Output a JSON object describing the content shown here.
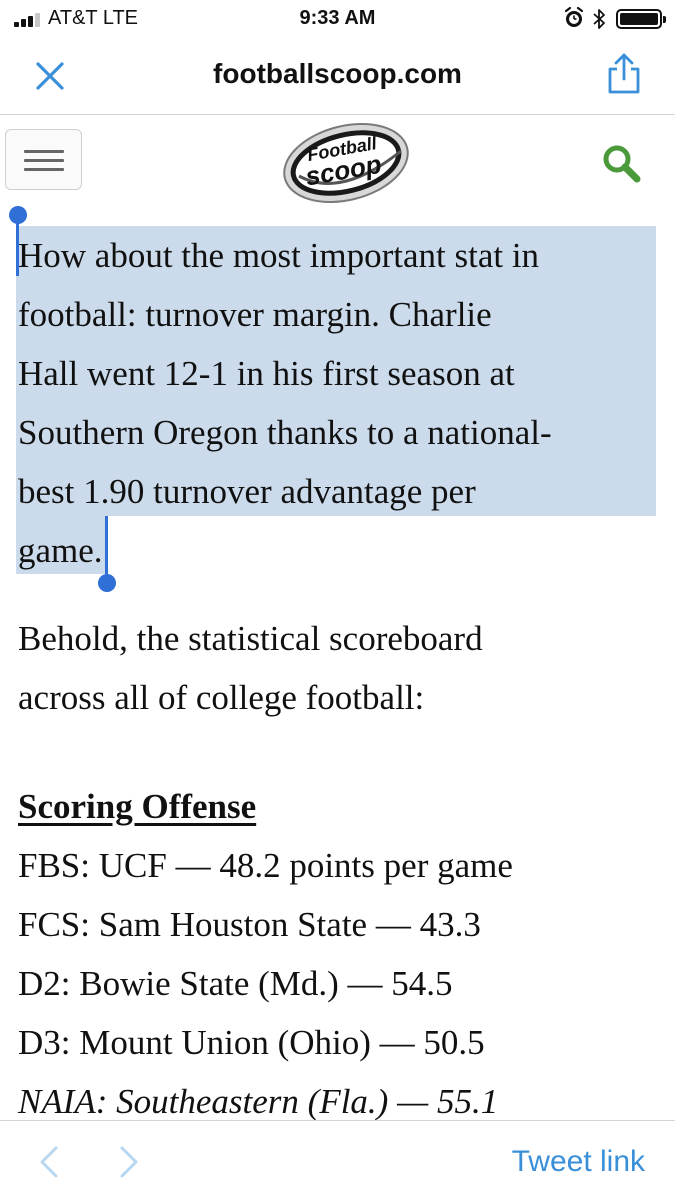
{
  "status_bar": {
    "carrier": "AT&T  LTE",
    "time": "9:33 AM",
    "icons": [
      "signal-icon",
      "alarm-icon",
      "bluetooth-icon",
      "battery-icon"
    ]
  },
  "nav": {
    "url": "footballscoop.com",
    "close_icon": "close-icon",
    "share_icon": "share-icon"
  },
  "site_header": {
    "logo_line1": "Football",
    "logo_line2": "scoop",
    "menu_icon": "hamburger-menu-icon",
    "search_icon": "search-icon"
  },
  "article": {
    "paragraph1": "How about the most important stat in football: turnover margin. Charlie Hall went 12-1 in his first season at Southern Oregon thanks to a national-best 1.90 turnover advantage per game.",
    "paragraph1_lines": [
      "How about the most important stat in",
      "football: turnover margin. Charlie",
      "Hall went 12-1 in his first season at",
      "Southern Oregon thanks to a national-",
      "best 1.90 turnover advantage per",
      "game."
    ],
    "paragraph2_lines": [
      "Behold, the statistical scoreboard",
      "across all of college football:"
    ],
    "section_heading": "Scoring Offense",
    "stats": [
      "FBS: UCF — 48.2 points per game",
      "FCS: Sam Houston State — 43.3",
      "D2: Bowie State (Md.) — 54.5",
      "D3: Mount Union (Ohio) — 50.5",
      "NAIA: Southeastern (Fla.) — 55.1"
    ]
  },
  "toolbar": {
    "back_icon": "chevron-left-icon",
    "forward_icon": "chevron-right-icon",
    "tweet_link": "Tweet link"
  },
  "colors": {
    "selection": "#cbdbeb",
    "selection_handle": "#2f6fd6",
    "link": "#3a8fd9",
    "search_icon": "#4a9a3a"
  }
}
